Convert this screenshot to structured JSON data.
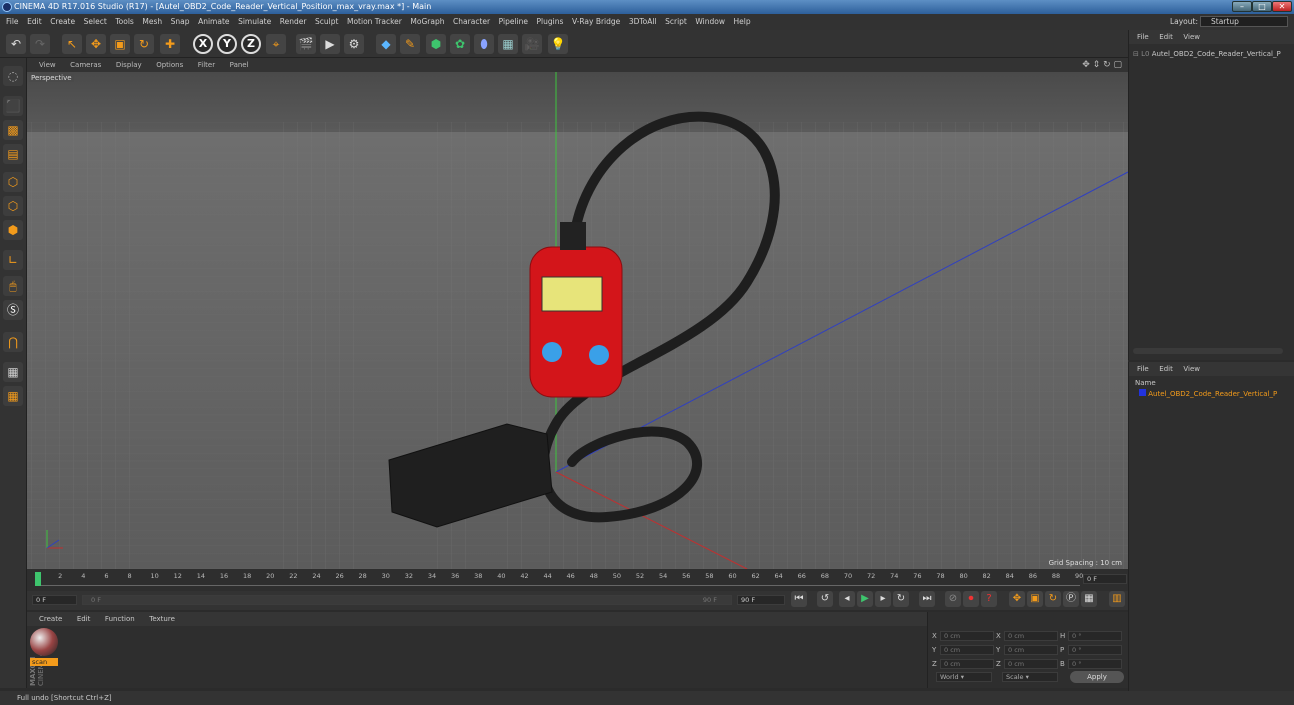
{
  "window": {
    "title": "CINEMA 4D R17.016 Studio (R17) - [Autel_OBD2_Code_Reader_Vertical_Position_max_vray.max *] - Main"
  },
  "menubar": {
    "items": [
      "File",
      "Edit",
      "Create",
      "Select",
      "Tools",
      "Mesh",
      "Snap",
      "Animate",
      "Simulate",
      "Render",
      "Sculpt",
      "Motion Tracker",
      "MoGraph",
      "Character",
      "Pipeline",
      "Plugins",
      "V-Ray Bridge",
      "3DToAll",
      "Script",
      "Window",
      "Help"
    ],
    "layout_label": "Layout:",
    "layout_value": "Startup"
  },
  "toolbar": {
    "axis_x": "X",
    "axis_y": "Y",
    "axis_z": "Z"
  },
  "viewport": {
    "menu": [
      "View",
      "Cameras",
      "Display",
      "Options",
      "Filter",
      "Panel"
    ],
    "label": "Perspective",
    "grid_spacing": "Grid Spacing : 10 cm"
  },
  "timeline": {
    "ticks": [
      "0",
      "2",
      "4",
      "6",
      "8",
      "10",
      "12",
      "14",
      "16",
      "18",
      "20",
      "22",
      "24",
      "26",
      "28",
      "30",
      "32",
      "34",
      "36",
      "38",
      "40",
      "42",
      "44",
      "46",
      "48",
      "50",
      "52",
      "54",
      "56",
      "58",
      "60",
      "62",
      "64",
      "66",
      "68",
      "70",
      "72",
      "74",
      "76",
      "78",
      "80",
      "82",
      "84",
      "86",
      "88",
      "90"
    ],
    "current_frame": "0 F",
    "start_field": "0 F",
    "range_start": "0 F",
    "range_end": "90 F",
    "end_field": "90 F"
  },
  "material_manager": {
    "menu": [
      "Create",
      "Edit",
      "Function",
      "Texture"
    ],
    "material_name": "scan",
    "brand_line1": "MAXON",
    "brand_line2": "CINEMA 4D"
  },
  "coordinates": {
    "rows": [
      {
        "a": "X",
        "av": "0 cm",
        "b": "X",
        "bv": "0 cm",
        "c": "H",
        "cv": "0 °"
      },
      {
        "a": "Y",
        "av": "0 cm",
        "b": "Y",
        "bv": "0 cm",
        "c": "P",
        "cv": "0 °"
      },
      {
        "a": "Z",
        "av": "0 cm",
        "b": "Z",
        "bv": "0 cm",
        "c": "B",
        "cv": "0 °"
      }
    ],
    "world": "World",
    "scale": "Scale",
    "apply": "Apply"
  },
  "object_manager": {
    "menu": [
      "File",
      "Edit",
      "View"
    ],
    "object": "Autel_OBD2_Code_Reader_Vertical_P"
  },
  "attribute_manager": {
    "menu": [
      "File",
      "Edit",
      "View"
    ],
    "name_header": "Name",
    "object": "Autel_OBD2_Code_Reader_Vertical_P"
  },
  "status": {
    "text": "Full undo [Shortcut Ctrl+Z]"
  },
  "colors": {
    "accent": "#f39b1b",
    "title_blue": "#2d5f9a",
    "device_red": "#d3151a"
  }
}
